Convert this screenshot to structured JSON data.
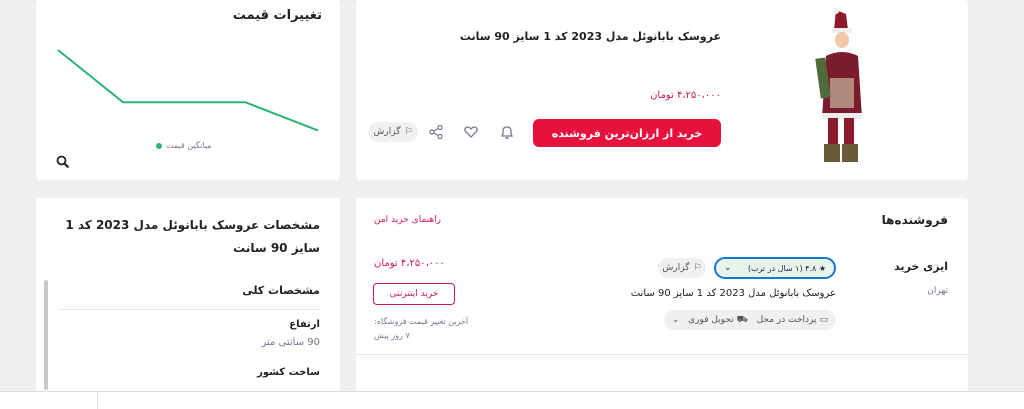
{
  "price_history": {
    "title": "تغییرات قیمت",
    "legend_label": "میانگین قیمت",
    "chart_data": {
      "type": "line",
      "title": "",
      "xlabel": "",
      "ylabel": "",
      "series": [
        {
          "name": "میانگین قیمت",
          "values": [
            10,
            5.2,
            5.2,
            5.2,
            5.2,
            2.6
          ],
          "color": "#2bb673"
        }
      ]
    }
  },
  "product": {
    "title": "عروسک بابانوئل مدل 2023 کد 1 سایز 90 سانت",
    "price": "۴،۲۵۰،۰۰۰ تومان",
    "buy_label": "خرید از ارزان‌ترین فروشنده",
    "report_label": "گزارش"
  },
  "sellers": {
    "title": "فروشنده‌ها",
    "safe_guide": "راهنمای خرید امن",
    "seller_name": "ایزی خرید",
    "seller_city": "تهران",
    "rating": "۴.۸ (۱ سال در ترب)",
    "report_label": "گزارش",
    "offer_title": "عروسک بابانوئل مدل 2023 کد 1 سایز 90 سانت",
    "payment": "پرداخت در محل",
    "delivery": "تحویل فوری",
    "price": "۴،۲۵۰،۰۰۰ تومان",
    "online_buy": "خرید اینترنتی",
    "last_change_label": "آخرین تغییر قیمت فروشگاه:",
    "last_change_value": "۷ روز پیش"
  },
  "specs": {
    "title": "مشخصات عروسک بابانوئل مدل 2023 کد 1 سایز 90 سانت",
    "section": "مشخصات کلی",
    "rows": [
      {
        "label": "ارتفاع",
        "value": "90 سانتی متر"
      },
      {
        "label": "ساخت کشور",
        "value": ""
      }
    ]
  },
  "colors": {
    "accent": "#e6123d",
    "price": "#d11b4f",
    "chart": "#2bb673",
    "rating_border": "#1976d2"
  }
}
